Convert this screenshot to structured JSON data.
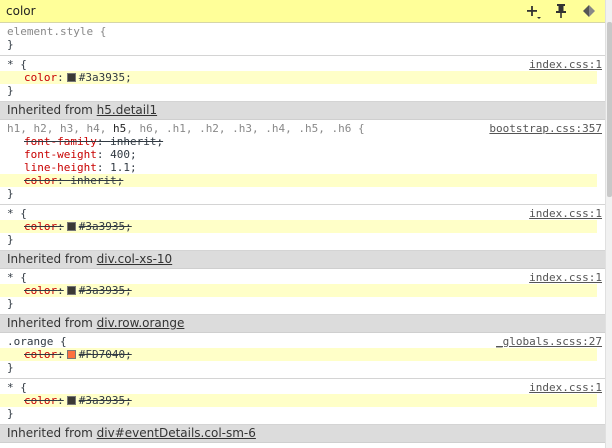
{
  "filter": {
    "text": "color"
  },
  "rules": {
    "element_style": {
      "selector": "element.style {",
      "close": "}"
    },
    "r1": {
      "selector": "* {",
      "source": "index.css:1",
      "prop": "color",
      "value": "#3a3935;",
      "swatch": "#3a3935",
      "close": "}"
    },
    "inh1": {
      "prefix": "Inherited from ",
      "element": "h5.detail1"
    },
    "r2": {
      "selector_pre": "h1, h2, h3, h4, ",
      "selector_match": "h5",
      "selector_post": ", h6, .h1, .h2, .h3, .h4, .h5, .h6 {",
      "source": "bootstrap.css:357",
      "props": [
        {
          "name": "font-family",
          "value": "inherit;"
        },
        {
          "name": "font-weight",
          "value": "400;"
        },
        {
          "name": "line-height",
          "value": "1.1;"
        },
        {
          "name": "color",
          "value": "inherit;"
        }
      ],
      "close": "}"
    },
    "r3": {
      "selector": "* {",
      "source": "index.css:1",
      "prop": "color",
      "value": "#3a3935;",
      "swatch": "#3a3935",
      "close": "}"
    },
    "inh2": {
      "prefix": "Inherited from ",
      "element": "div.col-xs-10"
    },
    "r4": {
      "selector": "* {",
      "source": "index.css:1",
      "prop": "color",
      "value": "#3a3935;",
      "swatch": "#3a3935",
      "close": "}"
    },
    "inh3": {
      "prefix": "Inherited from ",
      "element": "div.row.orange"
    },
    "r5": {
      "selector": ".orange {",
      "source": "_globals.scss:27",
      "prop": "color",
      "value": "#FD7040;",
      "swatch": "#FD7040",
      "close": "}"
    },
    "r6": {
      "selector": "* {",
      "source": "index.css:1",
      "prop": "color",
      "value": "#3a3935;",
      "swatch": "#3a3935",
      "close": "}"
    },
    "inh4": {
      "prefix": "Inherited from ",
      "element": "div#eventDetails.col-sm-6"
    }
  },
  "icons": {
    "new_rule": "plus-icon",
    "pin": "pin-icon",
    "toggle": "element-state-icon"
  }
}
